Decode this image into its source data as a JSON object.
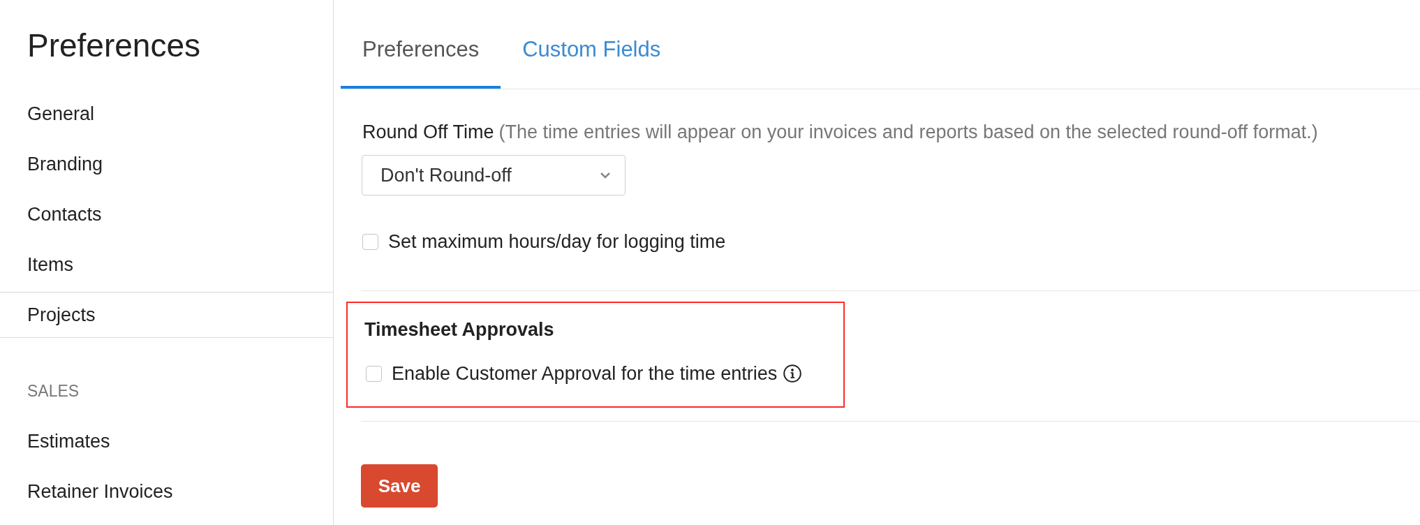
{
  "sidebar": {
    "title": "Preferences",
    "sections": [
      {
        "items": [
          {
            "label": "General",
            "selected": false
          },
          {
            "label": "Branding",
            "selected": false
          },
          {
            "label": "Contacts",
            "selected": false
          },
          {
            "label": "Items",
            "selected": false
          },
          {
            "label": "Projects",
            "selected": true
          }
        ]
      },
      {
        "heading": "SALES",
        "items": [
          {
            "label": "Estimates",
            "selected": false
          },
          {
            "label": "Retainer Invoices",
            "selected": false
          }
        ]
      }
    ]
  },
  "tabs": [
    {
      "label": "Preferences",
      "selected": true
    },
    {
      "label": "Custom Fields",
      "selected": false
    }
  ],
  "round_off_time": {
    "label": "Round Off Time",
    "hint": "(The time entries will appear on your invoices and reports based on the selected round-off format.)",
    "value": "Don't Round-off"
  },
  "max_hours": {
    "label": "Set maximum hours/day for logging time",
    "checked": false
  },
  "timesheet_approvals": {
    "title": "Timesheet Approvals",
    "highlighted": true,
    "option": {
      "label": "Enable Customer Approval for the time entries",
      "checked": false
    }
  },
  "save_button": {
    "label": "Save"
  }
}
